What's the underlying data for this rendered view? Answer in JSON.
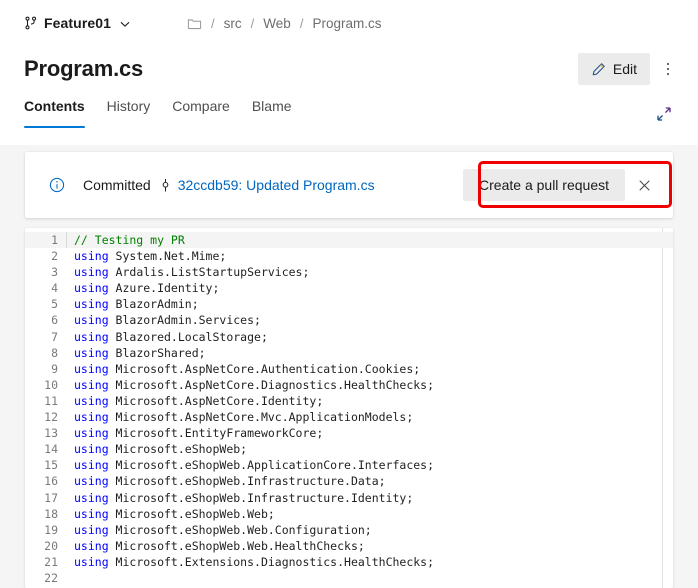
{
  "branch": {
    "name": "Feature01",
    "icon": "git-branch-icon",
    "chevron": "chevron-down-icon"
  },
  "breadcrumb": {
    "root_icon": "folder-icon",
    "separator": "/",
    "items": [
      "src",
      "Web",
      "Program.cs"
    ]
  },
  "page_title": "Program.cs",
  "toolbar": {
    "edit_label": "Edit",
    "edit_icon": "pencil-icon",
    "more_icon": "kebab-menu-icon"
  },
  "tabs": [
    {
      "label": "Contents",
      "active": true
    },
    {
      "label": "History",
      "active": false
    },
    {
      "label": "Compare",
      "active": false
    },
    {
      "label": "Blame",
      "active": false
    }
  ],
  "expand_icon": "expand-diagonal-icon",
  "notice": {
    "info_icon": "info-circle-icon",
    "status": "Committed",
    "commit_icon": "git-commit-icon",
    "commit_link": "32ccdb59: Updated Program.cs",
    "pr_button": "Create a pull request",
    "close_icon": "close-icon"
  },
  "annotation": {
    "color": "#ee0000",
    "target": "Create a pull request"
  },
  "colors": {
    "accent": "#0078d4",
    "link": "#0066bf",
    "keyword": "#0000ff",
    "comment": "#008000",
    "annotation": "#ee0000",
    "page_bg": "#f5f5f5"
  },
  "code": {
    "language": "csharp",
    "highlighted_line": 1,
    "lines": [
      {
        "n": "1",
        "tokens": [
          {
            "t": "cmt",
            "v": "// Testing my PR"
          }
        ]
      },
      {
        "n": "2",
        "tokens": [
          {
            "t": "kw",
            "v": "using"
          },
          {
            "t": "txt",
            "v": " System.Net.Mime;"
          }
        ]
      },
      {
        "n": "3",
        "tokens": [
          {
            "t": "kw",
            "v": "using"
          },
          {
            "t": "txt",
            "v": " Ardalis.ListStartupServices;"
          }
        ]
      },
      {
        "n": "4",
        "tokens": [
          {
            "t": "kw",
            "v": "using"
          },
          {
            "t": "txt",
            "v": " Azure.Identity;"
          }
        ]
      },
      {
        "n": "5",
        "tokens": [
          {
            "t": "kw",
            "v": "using"
          },
          {
            "t": "txt",
            "v": " BlazorAdmin;"
          }
        ]
      },
      {
        "n": "6",
        "tokens": [
          {
            "t": "kw",
            "v": "using"
          },
          {
            "t": "txt",
            "v": " BlazorAdmin.Services;"
          }
        ]
      },
      {
        "n": "7",
        "tokens": [
          {
            "t": "kw",
            "v": "using"
          },
          {
            "t": "txt",
            "v": " Blazored.LocalStorage;"
          }
        ]
      },
      {
        "n": "8",
        "tokens": [
          {
            "t": "kw",
            "v": "using"
          },
          {
            "t": "txt",
            "v": " BlazorShared;"
          }
        ]
      },
      {
        "n": "9",
        "tokens": [
          {
            "t": "kw",
            "v": "using"
          },
          {
            "t": "txt",
            "v": " Microsoft.AspNetCore.Authentication.Cookies;"
          }
        ]
      },
      {
        "n": "10",
        "tokens": [
          {
            "t": "kw",
            "v": "using"
          },
          {
            "t": "txt",
            "v": " Microsoft.AspNetCore.Diagnostics.HealthChecks;"
          }
        ]
      },
      {
        "n": "11",
        "tokens": [
          {
            "t": "kw",
            "v": "using"
          },
          {
            "t": "txt",
            "v": " Microsoft.AspNetCore.Identity;"
          }
        ]
      },
      {
        "n": "12",
        "tokens": [
          {
            "t": "kw",
            "v": "using"
          },
          {
            "t": "txt",
            "v": " Microsoft.AspNetCore.Mvc.ApplicationModels;"
          }
        ]
      },
      {
        "n": "13",
        "tokens": [
          {
            "t": "kw",
            "v": "using"
          },
          {
            "t": "txt",
            "v": " Microsoft.EntityFrameworkCore;"
          }
        ]
      },
      {
        "n": "14",
        "tokens": [
          {
            "t": "kw",
            "v": "using"
          },
          {
            "t": "txt",
            "v": " Microsoft.eShopWeb;"
          }
        ]
      },
      {
        "n": "15",
        "tokens": [
          {
            "t": "kw",
            "v": "using"
          },
          {
            "t": "txt",
            "v": " Microsoft.eShopWeb.ApplicationCore.Interfaces;"
          }
        ]
      },
      {
        "n": "16",
        "tokens": [
          {
            "t": "kw",
            "v": "using"
          },
          {
            "t": "txt",
            "v": " Microsoft.eShopWeb.Infrastructure.Data;"
          }
        ]
      },
      {
        "n": "17",
        "tokens": [
          {
            "t": "kw",
            "v": "using"
          },
          {
            "t": "txt",
            "v": " Microsoft.eShopWeb.Infrastructure.Identity;"
          }
        ]
      },
      {
        "n": "18",
        "tokens": [
          {
            "t": "kw",
            "v": "using"
          },
          {
            "t": "txt",
            "v": " Microsoft.eShopWeb.Web;"
          }
        ]
      },
      {
        "n": "19",
        "tokens": [
          {
            "t": "kw",
            "v": "using"
          },
          {
            "t": "txt",
            "v": " Microsoft.eShopWeb.Web.Configuration;"
          }
        ]
      },
      {
        "n": "20",
        "tokens": [
          {
            "t": "kw",
            "v": "using"
          },
          {
            "t": "txt",
            "v": " Microsoft.eShopWeb.Web.HealthChecks;"
          }
        ]
      },
      {
        "n": "21",
        "tokens": [
          {
            "t": "kw",
            "v": "using"
          },
          {
            "t": "txt",
            "v": " Microsoft.Extensions.Diagnostics.HealthChecks;"
          }
        ]
      },
      {
        "n": "22",
        "tokens": [
          {
            "t": "txt",
            "v": ""
          }
        ]
      }
    ]
  }
}
